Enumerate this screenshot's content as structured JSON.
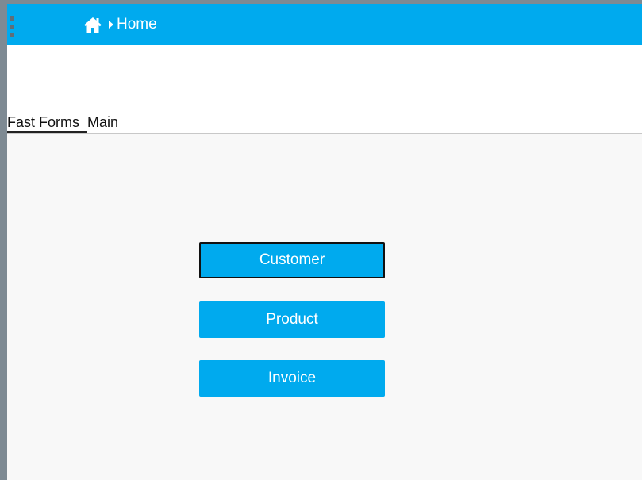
{
  "header": {
    "breadcrumb": {
      "home_icon": "home-icon",
      "separator_icon": "caret-right-icon",
      "current": "Home"
    },
    "colors": {
      "bar": "#00aaee",
      "frame": "#7e8a93"
    }
  },
  "tabs": [
    {
      "label": "Fast Forms",
      "active": true
    },
    {
      "label": "Main",
      "active": false
    }
  ],
  "main": {
    "buttons": [
      {
        "label": "Customer",
        "focused": true
      },
      {
        "label": "Product",
        "focused": false
      },
      {
        "label": "Invoice",
        "focused": false
      }
    ]
  }
}
